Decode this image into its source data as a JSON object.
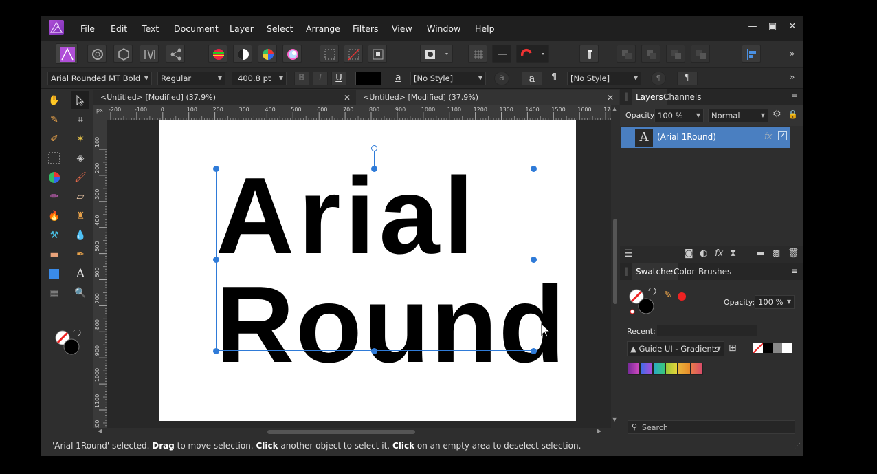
{
  "menu": [
    "File",
    "Edit",
    "Text",
    "Document",
    "Layer",
    "Select",
    "Arrange",
    "Filters",
    "View",
    "Window",
    "Help"
  ],
  "context_bar": {
    "font_family": "Arial Rounded MT Bold",
    "font_style": "Regular",
    "font_size": "400.8 pt",
    "bold": "B",
    "italic": "I",
    "underline": "U",
    "char_style": "[No Style]",
    "para_style": "[No Style]",
    "char_glyph": "a",
    "para_glyph": "¶"
  },
  "tabs": [
    {
      "label": "<Untitled> [Modified] (37.9%)"
    },
    {
      "label": "<Untitled> [Modified] (37.9%)"
    }
  ],
  "ruler": {
    "unit": "px",
    "h_ticks": [
      "-200",
      "-100",
      "0",
      "100",
      "200",
      "300",
      "400",
      "500",
      "600",
      "700",
      "800",
      "900",
      "1000",
      "1100",
      "1200",
      "1300",
      "1400",
      "1500",
      "1600",
      "170"
    ],
    "v_ticks": [
      "100",
      "200",
      "300",
      "400",
      "500",
      "600",
      "700",
      "800",
      "900",
      "1000",
      "1100",
      "1200"
    ]
  },
  "canvas": {
    "line1": "Arial",
    "line2": "Round"
  },
  "layers_panel": {
    "tabs": [
      "Layers",
      "Channels"
    ],
    "opacity_label": "Opacity:",
    "opacity_value": "100 %",
    "blend_mode": "Normal",
    "layer_name": "(Arial 1Round)",
    "layer_glyph": "A",
    "fx_label": "fx"
  },
  "swatches_panel": {
    "tabs": [
      "Swatches",
      "Color",
      "Brushes"
    ],
    "opacity_label": "Opacity:",
    "opacity_value": "100 %",
    "recent_label": "Recent:",
    "palette_name": "Guide UI - Gradients",
    "search_placeholder": "Search",
    "palette_colors": [
      "#b03aa8",
      "#4f5bd8",
      "#2bb5a0",
      "#c8c23a",
      "#e0a030",
      "#e06050"
    ]
  },
  "status": {
    "part1": "'Arial 1Round' selected. ",
    "drag": "Drag",
    "part2": " to move selection. ",
    "click1": "Click",
    "part3": " another object to select it. ",
    "click2": "Click",
    "part4": " on an empty area to deselect selection."
  },
  "colors": {
    "accent": "#4a7fc1",
    "selection_handle": "#2f7bd8",
    "app_bg": "#2e2e2e"
  }
}
